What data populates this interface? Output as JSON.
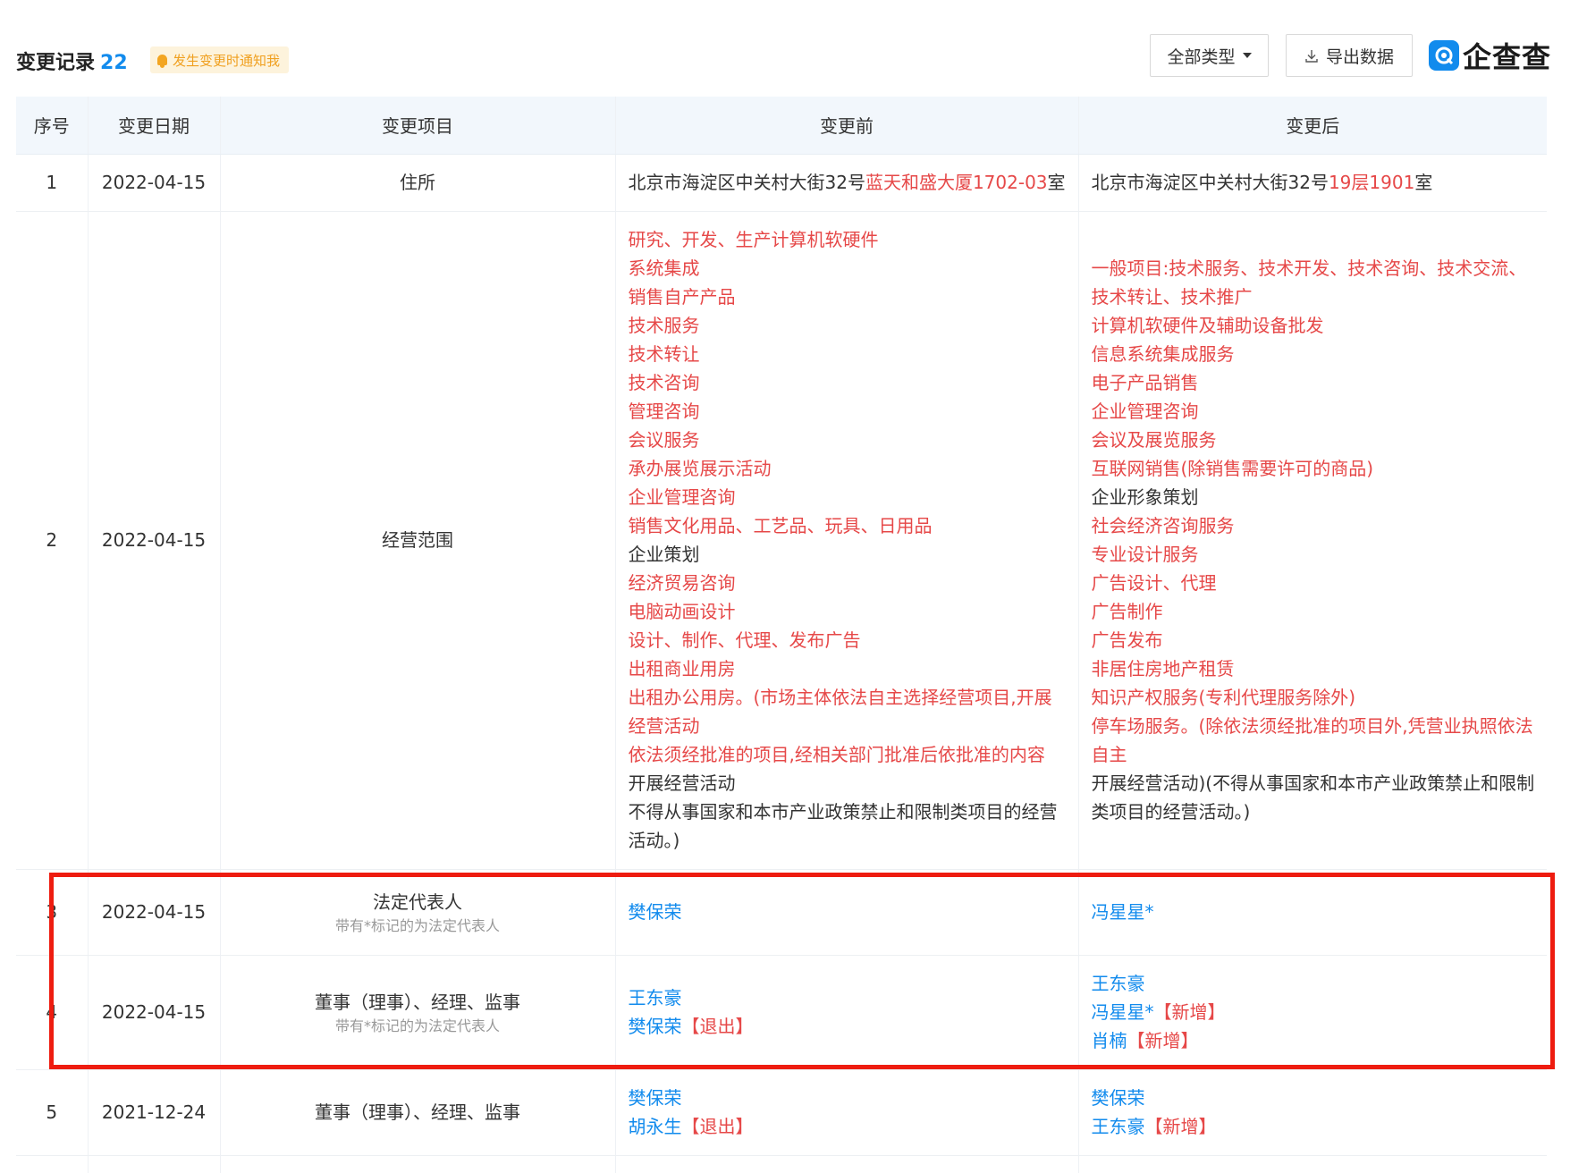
{
  "header": {
    "title": "变更记录",
    "count": "22",
    "notify_label": "发生变更时通知我",
    "type_filter_label": "全部类型",
    "export_label": "导出数据",
    "brand_name": "企查查"
  },
  "table": {
    "columns": [
      "序号",
      "变更日期",
      "变更项目",
      "变更前",
      "变更后"
    ],
    "row1": {
      "index": "1",
      "date": "2022-04-15",
      "item": "住所",
      "before_plain": "北京市海淀区中关村大街32号",
      "before_red": "蓝天和盛大厦1702-03",
      "before_tail": "室",
      "after_plain": "北京市海淀区中关村大街32号",
      "after_red": "19层1901",
      "after_tail": "室"
    },
    "row2": {
      "index": "2",
      "date": "2022-04-15",
      "item": "经营范围",
      "before": [
        {
          "text": "研究、开发、生产计算机软硬件",
          "red": true
        },
        {
          "text": "系统集成",
          "red": true
        },
        {
          "text": "销售自产产品",
          "red": true
        },
        {
          "text": "技术服务",
          "red": true
        },
        {
          "text": "技术转让",
          "red": true
        },
        {
          "text": "技术咨询",
          "red": true
        },
        {
          "text": "管理咨询",
          "red": true
        },
        {
          "text": "会议服务",
          "red": true
        },
        {
          "text": "承办展览展示活动",
          "red": true
        },
        {
          "text": "企业管理咨询",
          "red": true
        },
        {
          "text": "销售文化用品、工艺品、玩具、日用品",
          "red": true
        },
        {
          "text": "企业策划",
          "red": false
        },
        {
          "text": "经济贸易咨询",
          "red": true
        },
        {
          "text": "电脑动画设计",
          "red": true
        },
        {
          "text": "设计、制作、代理、发布广告",
          "red": true
        },
        {
          "text": "出租商业用房",
          "red": true
        },
        {
          "text": "出租办公用房。(市场主体依法自主选择经营项目,开展经营活动",
          "red": true
        },
        {
          "text": "依法须经批准的项目,经相关部门批准后依批准的内容",
          "red": true
        },
        {
          "text": "开展经营活动",
          "red": false
        },
        {
          "text": "不得从事国家和本市产业政策禁止和限制类项目的经营活动。)",
          "red": false
        }
      ],
      "after": [
        {
          "text": "一般项目:技术服务、技术开发、技术咨询、技术交流、技术转让、技术推广",
          "red": true
        },
        {
          "text": "计算机软硬件及辅助设备批发",
          "red": true
        },
        {
          "text": "信息系统集成服务",
          "red": true
        },
        {
          "text": "电子产品销售",
          "red": true
        },
        {
          "text": "企业管理咨询",
          "red": true
        },
        {
          "text": "会议及展览服务",
          "red": true
        },
        {
          "text": "互联网销售(除销售需要许可的商品)",
          "red": true
        },
        {
          "text": "企业形象策划",
          "red": false
        },
        {
          "text": "社会经济咨询服务",
          "red": true
        },
        {
          "text": "专业设计服务",
          "red": true
        },
        {
          "text": "广告设计、代理",
          "red": true
        },
        {
          "text": "广告制作",
          "red": true
        },
        {
          "text": "广告发布",
          "red": true
        },
        {
          "text": "非居住房地产租赁",
          "red": true
        },
        {
          "text": "知识产权服务(专利代理服务除外)",
          "red": true
        },
        {
          "text": "停车场服务。(除依法须经批准的项目外,凭营业执照依法自主",
          "red": true
        },
        {
          "text": "开展经营活动)(不得从事国家和本市产业政策禁止和限制类项目的经营活动。)",
          "red": false
        }
      ]
    },
    "row3": {
      "index": "3",
      "date": "2022-04-15",
      "item": "法定代表人",
      "hint": "带有*标记的为法定代表人",
      "before_person": "樊保荣",
      "after_person": "冯星星*"
    },
    "row4": {
      "index": "4",
      "date": "2022-04-15",
      "item": "董事（理事）、经理、监事",
      "hint": "带有*标记的为法定代表人",
      "before": [
        {
          "name": "王东豪",
          "tag": ""
        },
        {
          "name": "樊保荣",
          "tag": "【退出】"
        }
      ],
      "after": [
        {
          "name": "王东豪",
          "tag": ""
        },
        {
          "name": "冯星星*",
          "tag": "【新增】"
        },
        {
          "name": "肖楠",
          "tag": "【新增】"
        }
      ]
    },
    "row5": {
      "index": "5",
      "date": "2021-12-24",
      "item": "董事（理事）、经理、监事",
      "before": [
        {
          "name": "樊保荣",
          "tag": ""
        },
        {
          "name": "胡永生",
          "tag": "【退出】"
        }
      ],
      "after": [
        {
          "name": "樊保荣",
          "tag": ""
        },
        {
          "name": "王东豪",
          "tag": "【新增】"
        }
      ]
    }
  },
  "colors": {
    "link": "#128bed",
    "changed_text": "#e64848",
    "annotation_box": "#ee1c10",
    "header_bg": "#f2f7fc"
  }
}
